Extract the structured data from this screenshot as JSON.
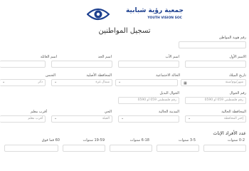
{
  "logo": {
    "name_ar": "جمعية رؤية شبابية",
    "name_en": "YOUTH VISION SOC"
  },
  "page_title": "تسجيل المواطنين",
  "fields": {
    "id_number": {
      "label": "رقم هوية المواطن",
      "value": ""
    },
    "first_name": {
      "label": "الاسم الأول",
      "value": ""
    },
    "father_name": {
      "label": "اسم الأب",
      "value": ""
    },
    "grandfather_name": {
      "label": "اسم الجد",
      "value": ""
    },
    "family_name": {
      "label": "اسم العائلة",
      "value": ""
    },
    "birth_date": {
      "label": "تاريخ الميلاد",
      "placeholder": "شهر/يوم/سنة"
    },
    "marital_status": {
      "label": "الحالة الاجتماعية",
      "value": ""
    },
    "original_governorate": {
      "label": "المحافظة الأصلية",
      "value": "شمال غزة"
    },
    "gender": {
      "label": "الجنس",
      "value": "ذكر"
    },
    "mobile": {
      "label": "رقم الجوال",
      "placeholder": "رقم فلسطيني 059 أو 0590"
    },
    "alt_mobile": {
      "label": "الجوال البديل",
      "placeholder": "رقم فلسطيني 059 أو 0590"
    },
    "current_governorate": {
      "label": "المحافظة الحالية",
      "value": "إختر المحافظة"
    },
    "current_city": {
      "label": "المدينة الحالية",
      "value": ""
    },
    "district": {
      "label": "الحي",
      "value": "القبلة"
    },
    "nearest_landmark": {
      "label": "أقرب معلم",
      "placeholder": "أقرب معلم"
    }
  },
  "members_section": {
    "title": "عدد الأفراد الإناث",
    "columns": [
      {
        "label": "0-2 سنوات"
      },
      {
        "label": "3-5 سنوات"
      },
      {
        "label": "6-18 سنوات"
      },
      {
        "label": "19-59 سنوات"
      },
      {
        "label": "60 فما فوق"
      }
    ]
  }
}
